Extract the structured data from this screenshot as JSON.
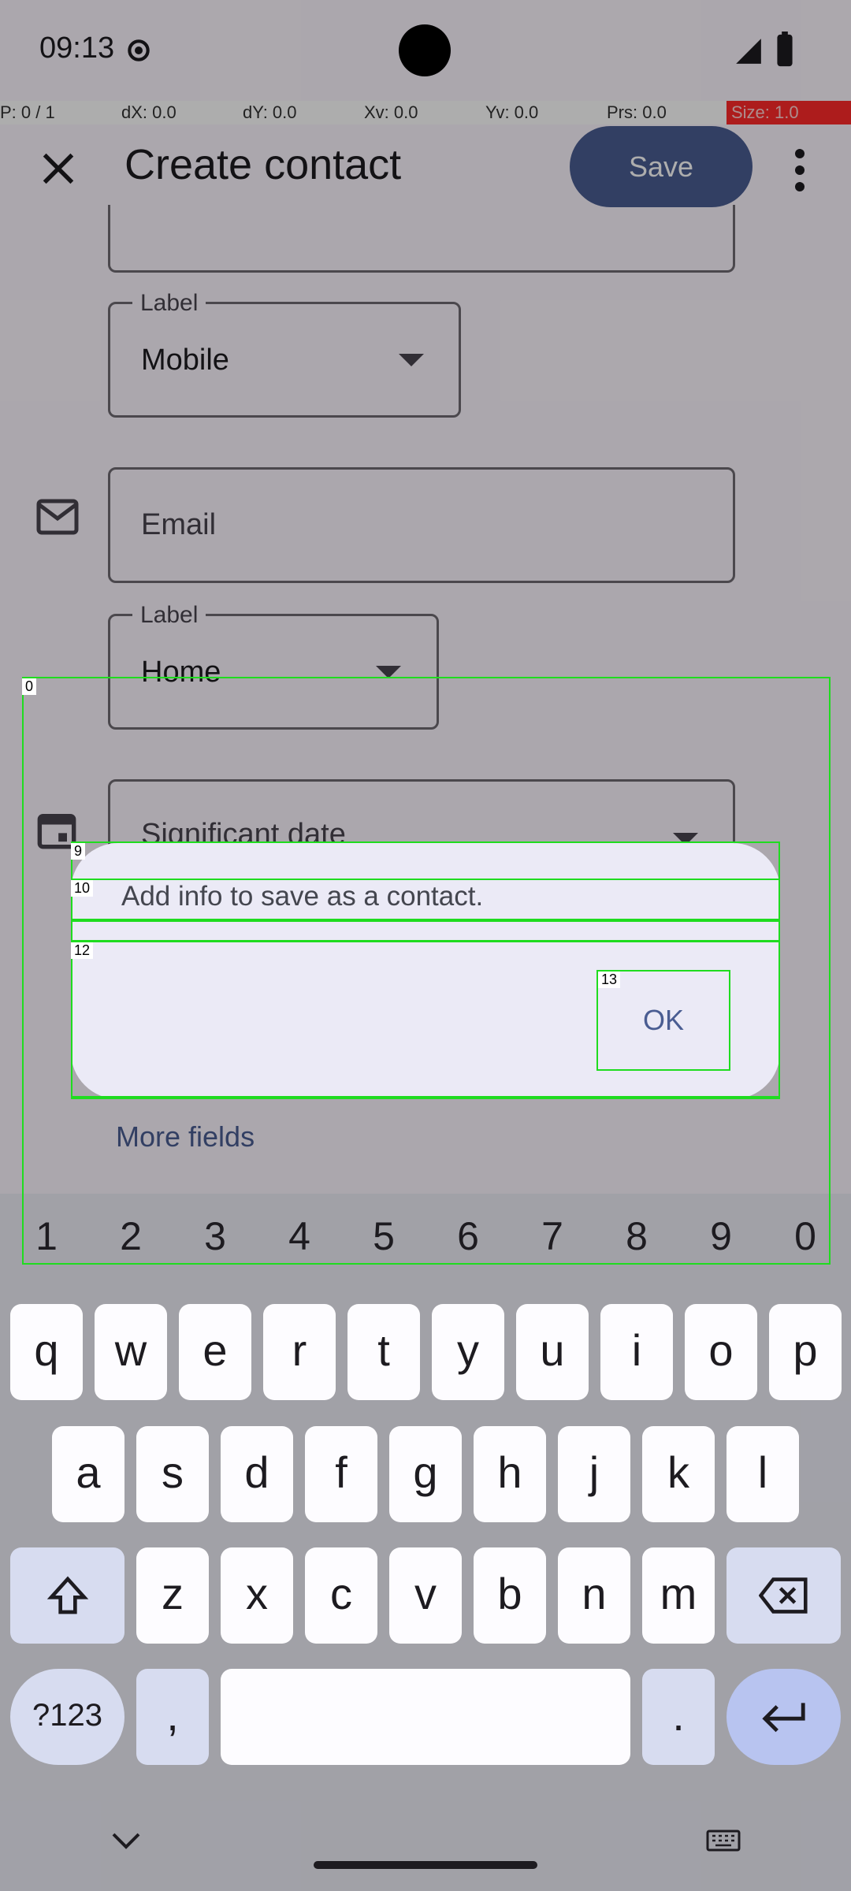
{
  "status_bar": {
    "time": "09:13"
  },
  "pointer_bar": {
    "p": "P: 0 / 1",
    "dx": "dX: 0.0",
    "dy": "dY: 0.0",
    "xv": "Xv: 0.0",
    "yv": "Yv: 0.0",
    "prs": "Prs: 0.0",
    "size": "Size: 1.0"
  },
  "app_bar": {
    "title": "Create contact",
    "save_label": "Save"
  },
  "form": {
    "phone_label_label": "Label",
    "phone_label_value": "Mobile",
    "email_placeholder": "Email",
    "email_label_label": "Label",
    "email_label_value": "Home",
    "date_placeholder": "Significant date",
    "more_fields": "More fields"
  },
  "dialog": {
    "message": "Add info to save as a contact.",
    "ok_label": "OK"
  },
  "overlay_ids": [
    "0",
    "9",
    "10",
    "12",
    "13"
  ],
  "keyboard": {
    "numbers": [
      "1",
      "2",
      "3",
      "4",
      "5",
      "6",
      "7",
      "8",
      "9",
      "0"
    ],
    "row1": [
      "q",
      "w",
      "e",
      "r",
      "t",
      "y",
      "u",
      "i",
      "o",
      "p"
    ],
    "row2": [
      "a",
      "s",
      "d",
      "f",
      "g",
      "h",
      "j",
      "k",
      "l"
    ],
    "row3": [
      "z",
      "x",
      "c",
      "v",
      "b",
      "n",
      "m"
    ],
    "symbols_label": "?123",
    "comma": ",",
    "period": "."
  },
  "colors": {
    "accent": "#4a5d92",
    "overlay": "#1fdc1f"
  }
}
